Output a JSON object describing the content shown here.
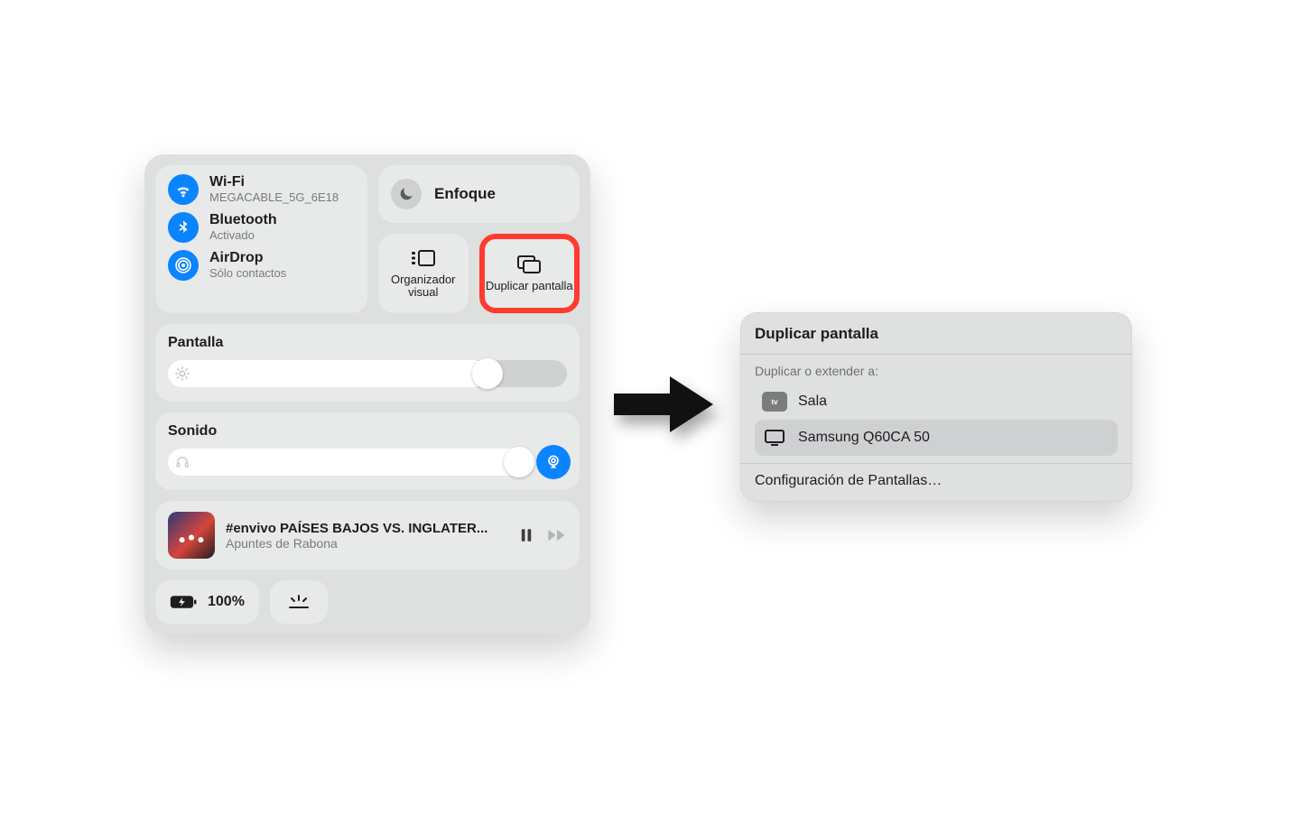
{
  "control_center": {
    "wifi": {
      "title": "Wi-Fi",
      "subtitle": "MEGACABLE_5G_6E18"
    },
    "bluetooth": {
      "title": "Bluetooth",
      "subtitle": "Activado"
    },
    "airdrop": {
      "title": "AirDrop",
      "subtitle": "Sólo contactos"
    },
    "focus": {
      "label": "Enfoque"
    },
    "stage_manager": {
      "label": "Organizador visual"
    },
    "screen_mirror": {
      "label": "Duplicar pantalla"
    },
    "brightness": {
      "label": "Pantalla",
      "percent": 80
    },
    "sound": {
      "label": "Sonido",
      "percent": 93
    },
    "now_playing": {
      "title": "#envivo PAÍSES BAJOS VS. INGLATER...",
      "subtitle": "Apuntes de Rabona"
    },
    "battery": {
      "label": "100%"
    }
  },
  "mirror_popup": {
    "title": "Duplicar pantalla",
    "subheader": "Duplicar o extender a:",
    "devices": [
      {
        "name": "Sala",
        "kind": "appletv",
        "selected": false
      },
      {
        "name": "Samsung Q60CA 50",
        "kind": "tv",
        "selected": true
      }
    ],
    "settings_link": "Configuración de Pantallas…"
  }
}
